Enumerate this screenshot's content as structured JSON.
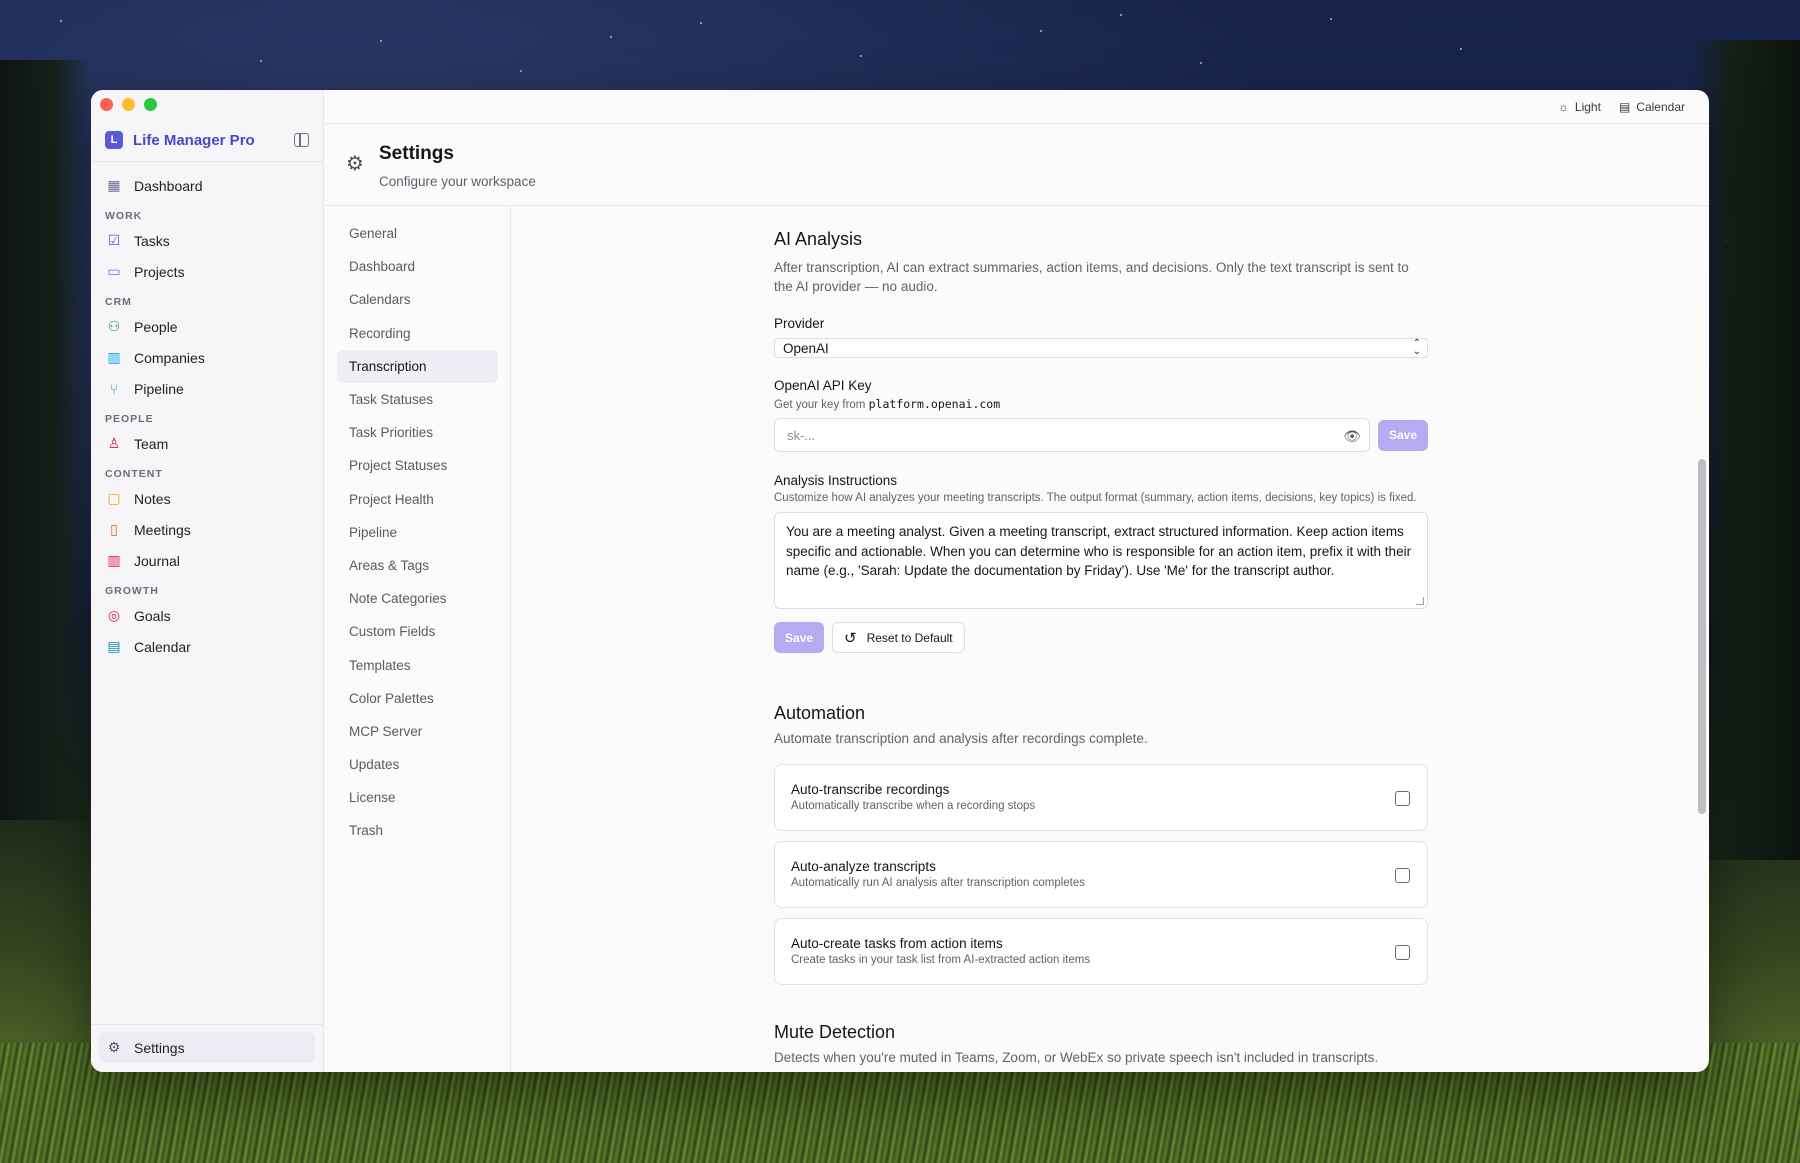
{
  "app": {
    "name": "Life Manager Pro",
    "logo_glyph": "L"
  },
  "sidebar": {
    "items": [
      {
        "type": "item",
        "label": "Dashboard",
        "icon": "layout-grid-icon",
        "glyph": "▦",
        "color": "#6a6a9a"
      },
      {
        "type": "section",
        "label": "WORK"
      },
      {
        "type": "item",
        "label": "Tasks",
        "icon": "checkbox-icon",
        "glyph": "☑",
        "color": "#5b5ad6"
      },
      {
        "type": "item",
        "label": "Projects",
        "icon": "folder-icon",
        "glyph": "▭",
        "color": "#8b5cf6"
      },
      {
        "type": "section",
        "label": "CRM"
      },
      {
        "type": "item",
        "label": "People",
        "icon": "users-icon",
        "glyph": "⚇",
        "color": "#16a34a"
      },
      {
        "type": "item",
        "label": "Companies",
        "icon": "building-icon",
        "glyph": "▥",
        "color": "#0ea5e9"
      },
      {
        "type": "item",
        "label": "Pipeline",
        "icon": "git-branch-icon",
        "glyph": "⑂",
        "color": "#14b8a6"
      },
      {
        "type": "section",
        "label": "PEOPLE"
      },
      {
        "type": "item",
        "label": "Team",
        "icon": "user-icon",
        "glyph": "♙",
        "color": "#e11d48"
      },
      {
        "type": "section",
        "label": "CONTENT"
      },
      {
        "type": "item",
        "label": "Notes",
        "icon": "note-icon",
        "glyph": "▢",
        "color": "#f59e0b"
      },
      {
        "type": "item",
        "label": "Meetings",
        "icon": "meetings-icon",
        "glyph": "▯",
        "color": "#ea580c"
      },
      {
        "type": "item",
        "label": "Journal",
        "icon": "book-open-icon",
        "glyph": "▥",
        "color": "#e11d48"
      },
      {
        "type": "section",
        "label": "GROWTH"
      },
      {
        "type": "item",
        "label": "Goals",
        "icon": "target-icon",
        "glyph": "◎",
        "color": "#e11d48"
      },
      {
        "type": "item",
        "label": "Calendar",
        "icon": "calendar-icon",
        "glyph": "▤",
        "color": "#0891b2"
      }
    ],
    "settings_label": "Settings"
  },
  "topbar": {
    "theme_label": "Light",
    "calendar_label": "Calendar"
  },
  "header": {
    "title": "Settings",
    "subtitle": "Configure your workspace"
  },
  "settings_nav": {
    "active": "Transcription",
    "items": [
      "General",
      "Dashboard",
      "Calendars",
      "Recording",
      "Transcription",
      "Task Statuses",
      "Task Priorities",
      "Project Statuses",
      "Project Health",
      "Pipeline",
      "Areas & Tags",
      "Note Categories",
      "Custom Fields",
      "Templates",
      "Color Palettes",
      "MCP Server",
      "Updates",
      "License",
      "Trash"
    ]
  },
  "ai_analysis": {
    "title": "AI Analysis",
    "description": "After transcription, AI can extract summaries, action items, and decisions. Only the text transcript is sent to the AI provider — no audio.",
    "provider_label": "Provider",
    "provider_value": "OpenAI",
    "api_key_label": "OpenAI API Key",
    "api_key_hint_prefix": "Get your key from",
    "api_key_hint_domain": "platform.openai.com",
    "api_key_placeholder": "sk-...",
    "save_label": "Save",
    "instructions_label": "Analysis Instructions",
    "instructions_hint": "Customize how AI analyzes your meeting transcripts. The output format (summary, action items, decisions, key topics) is fixed.",
    "instructions_value": "You are a meeting analyst. Given a meeting transcript, extract structured information. Keep action items specific and actionable. When you can determine who is responsible for an action item, prefix it with their name (e.g., 'Sarah: Update the documentation by Friday'). Use 'Me' for the transcript author.",
    "instructions_save_label": "Save",
    "reset_label": "Reset to Default"
  },
  "automation": {
    "title": "Automation",
    "description": "Automate transcription and analysis after recordings complete.",
    "toggles": [
      {
        "title": "Auto-transcribe recordings",
        "description": "Automatically transcribe when a recording stops",
        "checked": false
      },
      {
        "title": "Auto-analyze transcripts",
        "description": "Automatically run AI analysis after transcription completes",
        "checked": false
      },
      {
        "title": "Auto-create tasks from action items",
        "description": "Create tasks in your task list from AI-extracted action items",
        "checked": false
      }
    ]
  },
  "mute_detection": {
    "title": "Mute Detection",
    "description": "Detects when you're muted in Teams, Zoom, or WebEx so private speech isn't included in transcripts."
  }
}
